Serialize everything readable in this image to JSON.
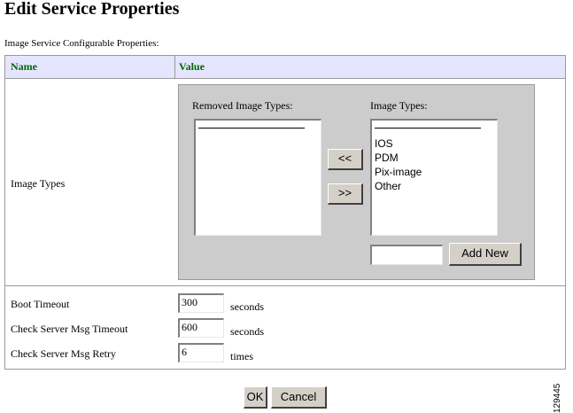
{
  "page": {
    "title": "Edit Service Properties",
    "section_label": "Image Service Configurable Properties:"
  },
  "table": {
    "col_name": "Name",
    "col_value": "Value"
  },
  "image_types": {
    "row_label": "Image Types",
    "removed_caption": "Removed Image Types:",
    "current_caption": "Image Types:",
    "removed_items": [],
    "items": [
      "IOS",
      "PDM",
      "Pix-image",
      "Other"
    ],
    "move_left_label": "<<",
    "move_right_label": ">>",
    "new_type_value": "",
    "add_new_label": "Add New"
  },
  "boot_timeout": {
    "label": "Boot Timeout",
    "value": "300",
    "unit": "seconds"
  },
  "msg_timeout": {
    "label": "Check Server Msg Timeout",
    "value": "600",
    "unit": "seconds"
  },
  "msg_retry": {
    "label": "Check Server Msg Retry",
    "value": "6",
    "unit": "times"
  },
  "footer": {
    "ok_label": "OK",
    "cancel_label": "Cancel"
  },
  "figure_id": "129445"
}
